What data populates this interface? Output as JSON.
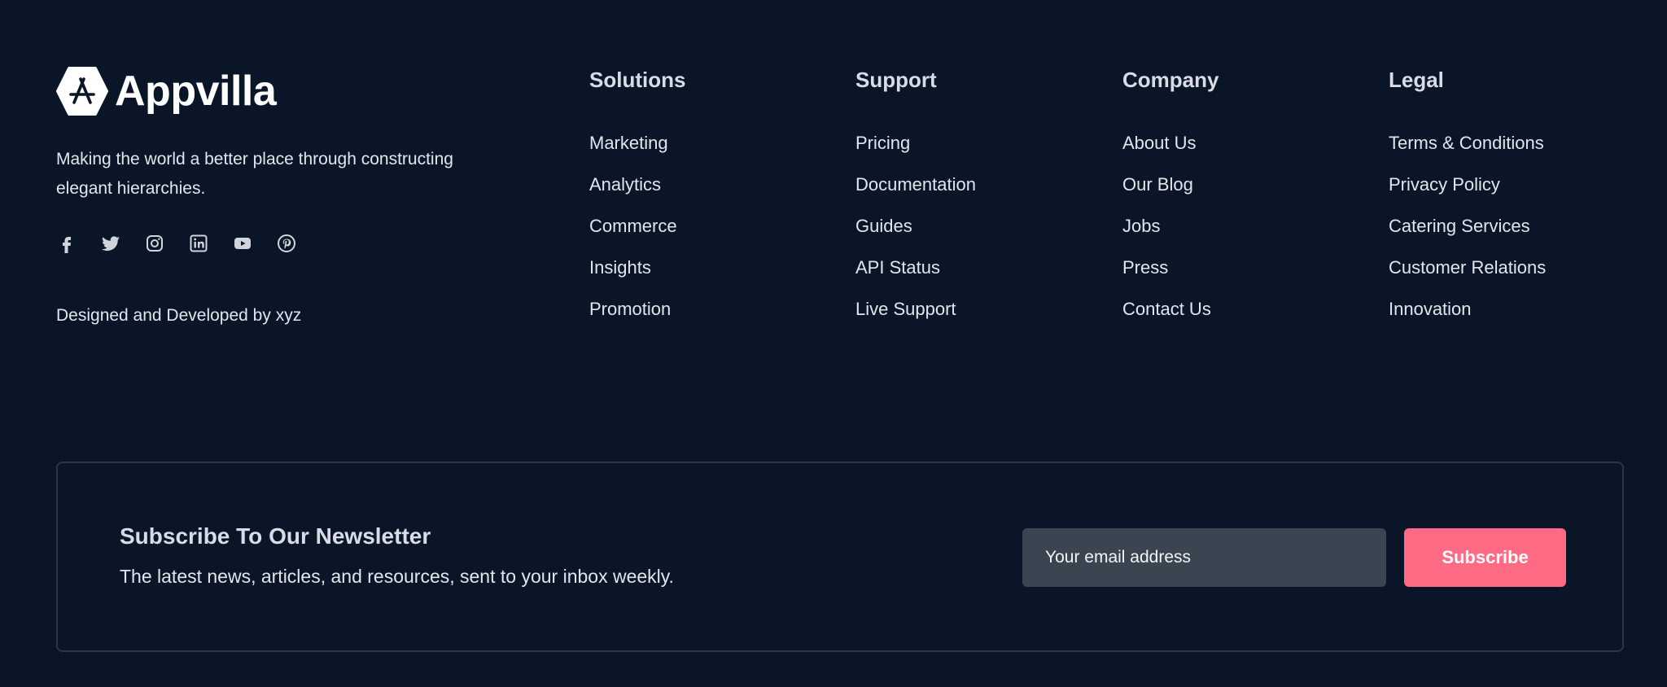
{
  "brand": {
    "name": "Appvilla",
    "tagline": "Making the world a better place through constructing elegant hierarchies.",
    "credit": "Designed and Developed by xyz",
    "socials": [
      "facebook-icon",
      "twitter-icon",
      "instagram-icon",
      "linkedin-icon",
      "youtube-icon",
      "pinterest-icon"
    ]
  },
  "columns": [
    {
      "title": "Solutions",
      "items": [
        "Marketing",
        "Analytics",
        "Commerce",
        "Insights",
        "Promotion"
      ]
    },
    {
      "title": "Support",
      "items": [
        "Pricing",
        "Documentation",
        "Guides",
        "API Status",
        "Live Support"
      ]
    },
    {
      "title": "Company",
      "items": [
        "About Us",
        "Our Blog",
        "Jobs",
        "Press",
        "Contact Us"
      ]
    },
    {
      "title": "Legal",
      "items": [
        "Terms & Conditions",
        "Privacy Policy",
        "Catering Services",
        "Customer Relations",
        "Innovation"
      ]
    }
  ],
  "newsletter": {
    "title": "Subscribe To Our Newsletter",
    "subtitle": "The latest news, articles, and resources, sent to your inbox weekly.",
    "placeholder": "Your email address",
    "button_label": "Subscribe"
  },
  "colors": {
    "background": "#0a1628",
    "accent": "#ff6b85",
    "input_bg": "#3b4451"
  }
}
